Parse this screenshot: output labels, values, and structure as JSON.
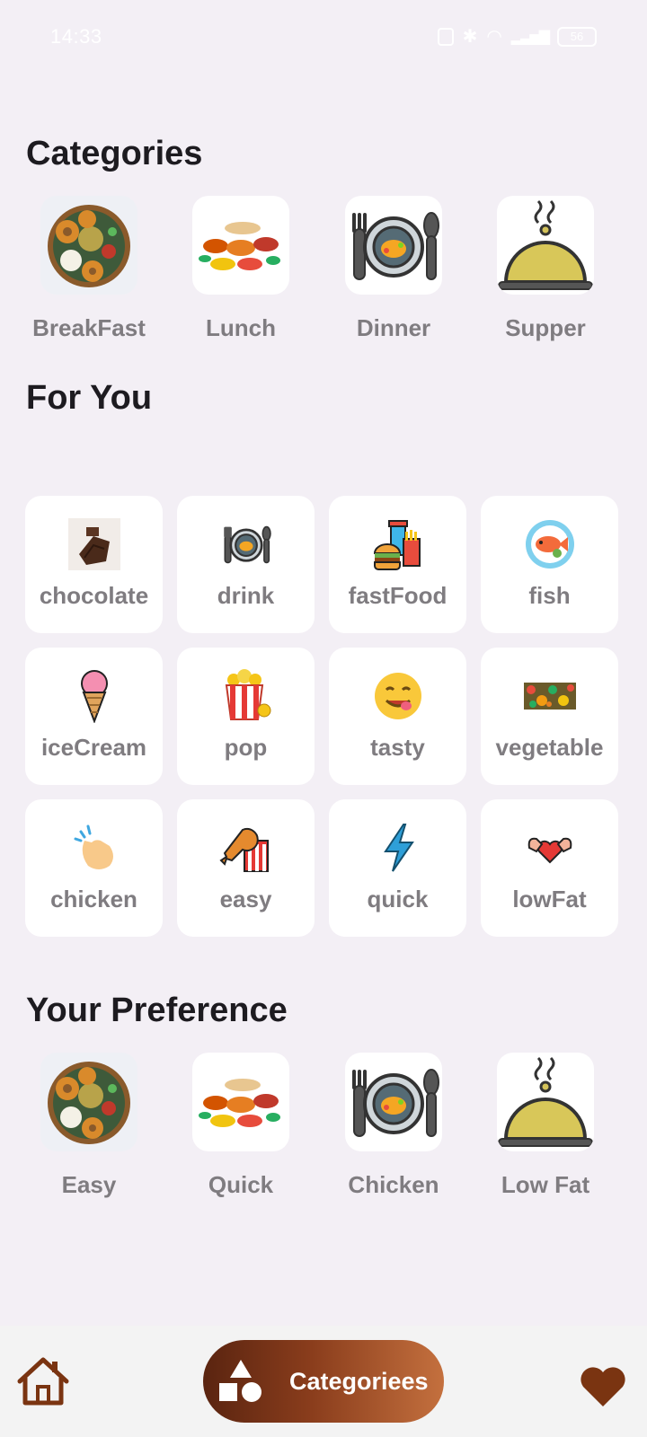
{
  "status_bar": {
    "time": "14:33",
    "battery": "56"
  },
  "sections": {
    "categories_title": "Categories",
    "for_you_title": "For You",
    "preference_title": "Your Preference"
  },
  "categories": [
    {
      "label": "BreakFast",
      "icon": "breakfast-photo"
    },
    {
      "label": "Lunch",
      "icon": "lunch-photo"
    },
    {
      "label": "Dinner",
      "icon": "plate-fork-spoon-icon"
    },
    {
      "label": "Supper",
      "icon": "cloche-icon"
    }
  ],
  "for_you": [
    {
      "label": "chocolate",
      "icon": "chocolate-icon"
    },
    {
      "label": "drink",
      "icon": "plate-fork-spoon-icon"
    },
    {
      "label": "fastFood",
      "icon": "fastfood-icon"
    },
    {
      "label": "fish",
      "icon": "fish-plate-icon"
    },
    {
      "label": "iceCream",
      "icon": "ice-cream-icon"
    },
    {
      "label": "pop",
      "icon": "popcorn-icon"
    },
    {
      "label": "tasty",
      "icon": "yum-face-icon"
    },
    {
      "label": "vegetable",
      "icon": "vegetables-icon"
    },
    {
      "label": "chicken",
      "icon": "snap-hand-icon"
    },
    {
      "label": "easy",
      "icon": "chicken-leg-icon"
    },
    {
      "label": "quick",
      "icon": "lightning-icon"
    },
    {
      "label": "lowFat",
      "icon": "strong-heart-icon"
    }
  ],
  "preferences": [
    {
      "label": "Easy",
      "icon": "breakfast-photo"
    },
    {
      "label": "Quick",
      "icon": "lunch-photo"
    },
    {
      "label": "Chicken",
      "icon": "plate-fork-spoon-icon"
    },
    {
      "label": "Low Fat",
      "icon": "cloche-icon"
    }
  ],
  "bottom_nav": {
    "active_label": "Categoriees",
    "items": [
      "home-icon",
      "categories-shapes-icon",
      "heart-icon"
    ]
  },
  "colors": {
    "accent_brown": "#7A3411",
    "accent_light": "#C4703E",
    "label_gray": "#7F7C80",
    "background": "#F3EFF5"
  }
}
